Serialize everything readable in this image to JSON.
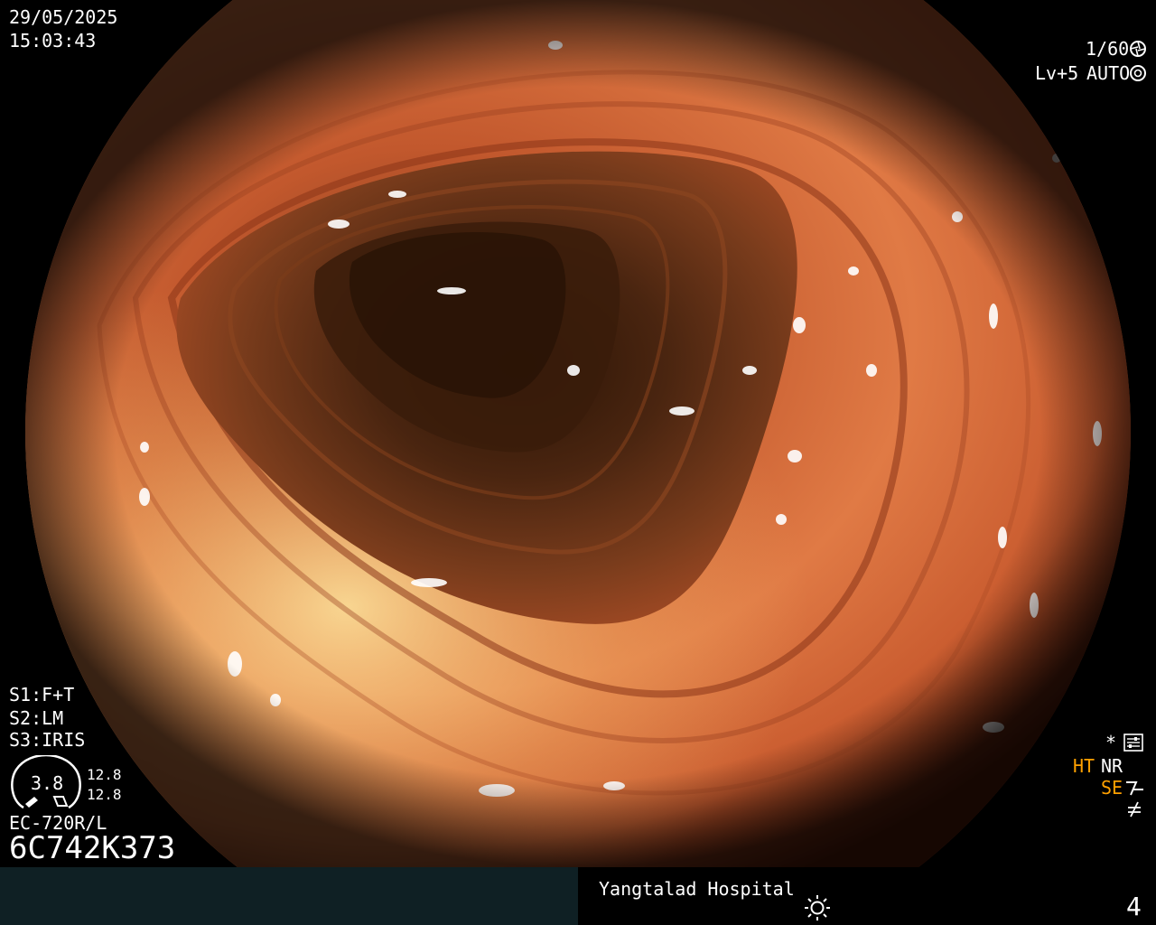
{
  "overlay": {
    "date": "29/05/2025",
    "time": "15:03:43",
    "shutter": "1/60",
    "level": "Lv+5",
    "iris_mode": "AUTO",
    "settings": [
      "S1:F+T",
      "S2:LM",
      "S3:IRIS"
    ],
    "gauge_value": "3.8",
    "gauge_readings": [
      "12.8",
      "12.8"
    ],
    "scope_model": "EC-720R/L",
    "serial": "6C742K373",
    "right_status": {
      "star": "*",
      "ht": "HT",
      "nr": "NR",
      "se": "SE"
    }
  },
  "footer": {
    "hospital": "Yangtalad Hospital",
    "page_number": "4"
  },
  "icons": {
    "shutter": "aperture-icon",
    "iris": "iris-icon",
    "menu": "sliders-icon",
    "se": "enhance-icon",
    "freeze": "freeze-icon",
    "light": "light-icon"
  },
  "colors": {
    "status_orange": "#ffa000",
    "footer_left": "#0f2024",
    "overlay_text": "#ffffff"
  }
}
